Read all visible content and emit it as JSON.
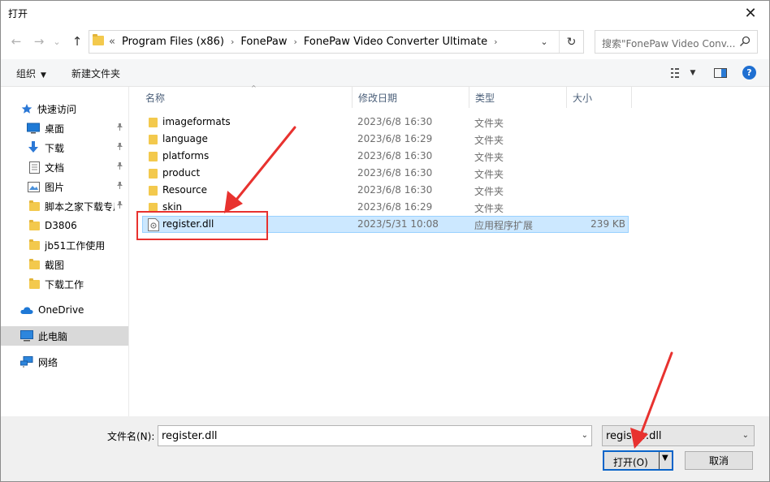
{
  "window": {
    "title": "打开",
    "close_glyph": "✕"
  },
  "nav": {
    "back_glyph": "←",
    "forward_glyph": "→",
    "recent_glyph": "⌄",
    "up_glyph": "↑",
    "addr_prefix": "«",
    "breadcrumbs": [
      "Program Files (x86)",
      "FonePaw",
      "FonePaw Video Converter Ultimate"
    ],
    "crumb_sep": "›",
    "addr_dropdown_glyph": "⌄",
    "refresh_glyph": "↻",
    "search_placeholder": "搜索\"FonePaw Video Conv..."
  },
  "toolbar": {
    "organize": "组织",
    "new_folder": "新建文件夹",
    "caret": "▼",
    "help": "?"
  },
  "sidebar": {
    "items": [
      {
        "label": "快速访问",
        "icon": "star-icon"
      },
      {
        "label": "桌面",
        "icon": "desktop-icon",
        "pinned": true
      },
      {
        "label": "下载",
        "icon": "download-icon",
        "pinned": true
      },
      {
        "label": "文档",
        "icon": "document-icon",
        "pinned": true
      },
      {
        "label": "图片",
        "icon": "picture-icon",
        "pinned": true
      },
      {
        "label": "脚本之家下载专用",
        "icon": "folder-icon",
        "pinned": true
      },
      {
        "label": "D3806",
        "icon": "folder-icon"
      },
      {
        "label": "jb51工作使用",
        "icon": "folder-icon"
      },
      {
        "label": "截图",
        "icon": "folder-icon"
      },
      {
        "label": "下载工作",
        "icon": "folder-icon"
      },
      {
        "label": "OneDrive",
        "icon": "cloud-icon"
      },
      {
        "label": "此电脑",
        "icon": "computer-icon",
        "selected": true
      },
      {
        "label": "网络",
        "icon": "network-icon"
      }
    ],
    "pin_glyph": "📌"
  },
  "columns": {
    "name": "名称",
    "date": "修改日期",
    "type": "类型",
    "size": "大小",
    "sort_glyph": "^"
  },
  "files": [
    {
      "name": "imageformats",
      "date": "2023/6/8 16:30",
      "type": "文件夹",
      "size": "",
      "kind": "folder"
    },
    {
      "name": "language",
      "date": "2023/6/8 16:29",
      "type": "文件夹",
      "size": "",
      "kind": "folder"
    },
    {
      "name": "platforms",
      "date": "2023/6/8 16:30",
      "type": "文件夹",
      "size": "",
      "kind": "folder"
    },
    {
      "name": "product",
      "date": "2023/6/8 16:30",
      "type": "文件夹",
      "size": "",
      "kind": "folder"
    },
    {
      "name": "Resource",
      "date": "2023/6/8 16:30",
      "type": "文件夹",
      "size": "",
      "kind": "folder"
    },
    {
      "name": "skin",
      "date": "2023/6/8 16:29",
      "type": "文件夹",
      "size": "",
      "kind": "folder"
    },
    {
      "name": "register.dll",
      "date": "2023/5/31 10:08",
      "type": "应用程序扩展",
      "size": "239 KB",
      "kind": "dll",
      "selected": true
    }
  ],
  "footer": {
    "filename_label": "文件名(N):",
    "filename_value": "register.dll",
    "filter_value": "register.dll",
    "open_label": "打开(O)",
    "cancel_label": "取消",
    "dd_glyph": "⌄",
    "split_glyph": "▼"
  },
  "colors": {
    "selection": "#cce8ff",
    "annotation_red": "#e8322f",
    "accent": "#0a64c9"
  }
}
